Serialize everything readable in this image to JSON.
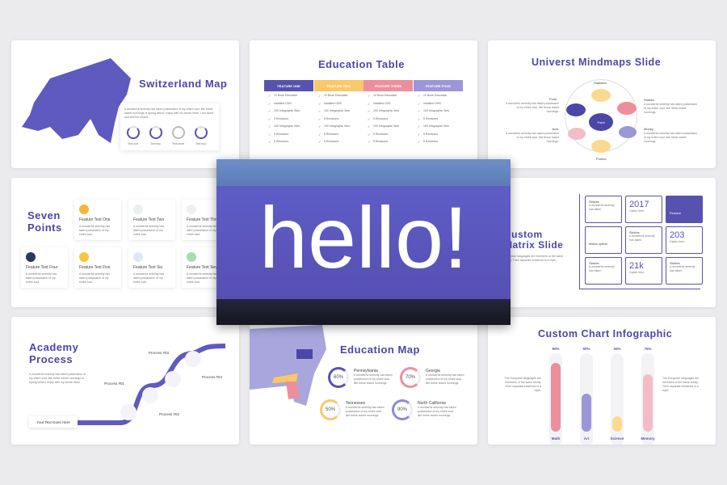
{
  "switzerland": {
    "title": "Switzerland Map",
    "text": "A wonderful serenity has taken possession of my entire soul, like these sweet mornings of spring which I enjoy with my whole heart. I am alone, and feel the charm.",
    "labels": [
      "Text one",
      "Text two",
      "Text three",
      "Text four"
    ]
  },
  "table": {
    "title": "Education Table",
    "headers": [
      "FEATURE ONE",
      "FEATURE TWO",
      "FEATURE THREE",
      "FEATURE FOUR"
    ],
    "header_colors": [
      "#5752b0",
      "#f8c86a",
      "#ec8f9c",
      "#9b97d6"
    ],
    "rows": [
      "10 Book Education",
      "Installed CMS",
      "100 Infographic Sets",
      "5 Revisions",
      "100 Infographic Sets",
      "5 Revisions",
      "5 Revisions"
    ]
  },
  "mindmap": {
    "title": "Universt Mindmaps Slide",
    "center": "Point",
    "nodes": [
      "Statistics",
      "Point",
      "Sickles",
      "Junk",
      "Money",
      "Protect"
    ],
    "desc": "A wonderful serenity has taken possession of my entire soul, like these sweet mornings."
  },
  "seven": {
    "title_1": "Seven",
    "title_2": "Points",
    "features": [
      "Feature Text One",
      "Feature Text Two",
      "Feature Text Three",
      "Feature Text Four",
      "Feature Text Five",
      "Feature Text Six",
      "Feature Text Seven"
    ],
    "desc": "A wonderful serenity has taken possession of my entire soul."
  },
  "hero": {
    "text": "hello!"
  },
  "matrix": {
    "title_1": "Custom",
    "title_2": "Matrix Slide",
    "desc": "European languages are members of the same family. Their separate existence is a myth.",
    "cells": [
      {
        "h": "Sickles",
        "s": "A wonderful serenity has taken"
      },
      {
        "h": "2017",
        "s": "Option here"
      },
      {
        "h": "Finance",
        "s": ""
      },
      {
        "h": "Matrix option",
        "s": ""
      },
      {
        "h": "Sickles",
        "s": "A wonderful serenity has taken"
      },
      {
        "h": "203",
        "s": "Option here"
      },
      {
        "h": "Sickles",
        "s": "A wonderful serenity has taken"
      },
      {
        "h": "21k",
        "s": "Option here"
      },
      {
        "h": "Sickles",
        "s": "A wonderful serenity has taken"
      }
    ]
  },
  "academy": {
    "title_1": "Academy",
    "title_2": "Process",
    "desc": "A wonderful serenity has taken possession of my entire soul, like these sweet mornings of spring which I enjoy with my whole heart.",
    "button": "Your Text Goes Here",
    "steps": [
      "Process #01",
      "Process #02",
      "Process #03",
      "Process #04"
    ],
    "step_desc": "A wonderful serenity has taken possession of my entire."
  },
  "edumap": {
    "title": "Education Map",
    "states": [
      {
        "name": "Pennsylvania",
        "pct": "60%",
        "color": "#5752b0"
      },
      {
        "name": "Georgia",
        "pct": "70%",
        "color": "#ec8f9c"
      },
      {
        "name": "Tennessee",
        "pct": "50%",
        "color": "#f8c86a"
      },
      {
        "name": "North California",
        "pct": "90%",
        "color": "#8e8ad6"
      }
    ],
    "desc": "A wonderful serenity has taken possession of my entire soul, like these sweet mornings."
  },
  "chart": {
    "title": "Custom Chart Infographic",
    "side_text": "The European languages are members of the same family. Their separate existence is a myth."
  },
  "chart_data": {
    "type": "bar",
    "categories": [
      "Math",
      "Art",
      "Science",
      "Memory"
    ],
    "values": [
      90,
      50,
      20,
      75
    ],
    "value_labels": [
      "90%",
      "50%",
      "20%",
      "75%"
    ],
    "colors": [
      "#ec8f9c",
      "#9b97d6",
      "#fbd98f",
      "#f4bcc6"
    ],
    "ylim": [
      0,
      100
    ]
  }
}
